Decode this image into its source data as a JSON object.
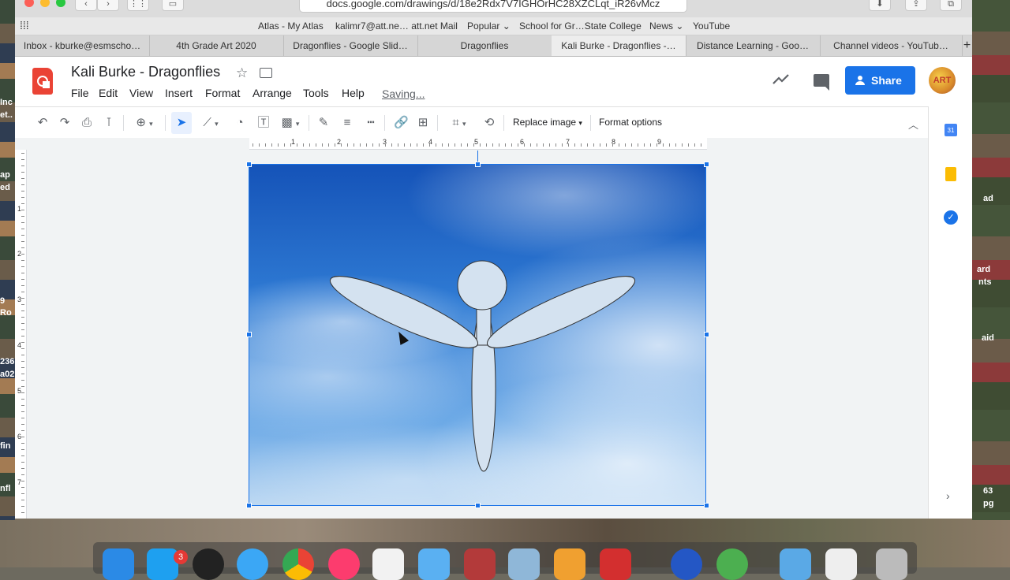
{
  "browser": {
    "url": "docs.google.com/drawings/d/18e2Rdx7V7IGHOrHC28XZCLqt_iR26vMcz",
    "bookmarks": [
      "Atlas - My Atlas",
      "kalimr7@att.ne… att.net Mail",
      "Popular",
      "School for Gr…State College",
      "News",
      "YouTube"
    ],
    "tabs": [
      "Inbox - kburke@esmscho…",
      "4th Grade Art 2020",
      "Dragonflies - Google Slid…",
      "Dragonflies",
      "Kali Burke - Dragonflies -…",
      "Distance Learning - Goo…",
      "Channel videos - YouTub…"
    ],
    "active_tab_index": 4,
    "new_tab_label": "+"
  },
  "docs": {
    "title": "Kali Burke - Dragonflies",
    "menu": [
      "File",
      "Edit",
      "View",
      "Insert",
      "Format",
      "Arrange",
      "Tools",
      "Help"
    ],
    "status": "Saving...",
    "share_label": "Share",
    "avatar_text": "ART"
  },
  "toolbar": {
    "replace_image_label": "Replace image",
    "format_options_label": "Format options",
    "zoom_label": "⊕"
  },
  "ruler": {
    "h_numbers": [
      "1",
      "2",
      "3",
      "4",
      "5",
      "6",
      "7",
      "8",
      "9"
    ],
    "v_numbers": [
      "1",
      "2",
      "3",
      "4",
      "5",
      "6",
      "7"
    ]
  },
  "side_panel": {
    "calendar_label": "31"
  },
  "desktop": {
    "left_texts": [
      "Inc",
      "et..",
      "ap",
      "ed",
      "9",
      "Ro",
      "236",
      "a02",
      "fin",
      "nfl"
    ],
    "right_texts": [
      "ad",
      "ard",
      "nts",
      "aid",
      "63",
      "pg"
    ],
    "dock_badge": "3"
  },
  "colors": {
    "accent": "#1a73e8",
    "shape_fill": "#d4e2f0",
    "logo": "#ea4335"
  }
}
